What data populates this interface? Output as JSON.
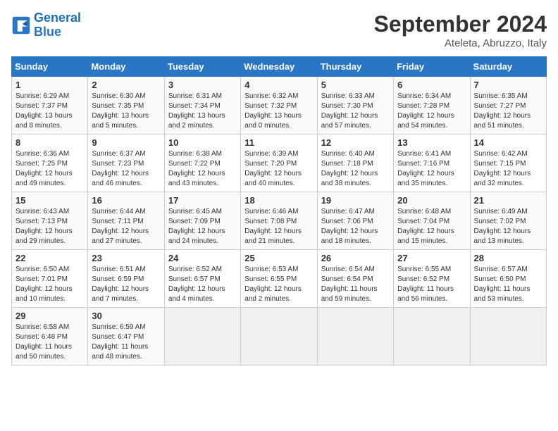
{
  "header": {
    "logo_line1": "General",
    "logo_line2": "Blue",
    "month": "September 2024",
    "location": "Ateleta, Abruzzo, Italy"
  },
  "weekdays": [
    "Sunday",
    "Monday",
    "Tuesday",
    "Wednesday",
    "Thursday",
    "Friday",
    "Saturday"
  ],
  "weeks": [
    [
      {
        "day": "1",
        "info": "Sunrise: 6:29 AM\nSunset: 7:37 PM\nDaylight: 13 hours\nand 8 minutes."
      },
      {
        "day": "2",
        "info": "Sunrise: 6:30 AM\nSunset: 7:35 PM\nDaylight: 13 hours\nand 5 minutes."
      },
      {
        "day": "3",
        "info": "Sunrise: 6:31 AM\nSunset: 7:34 PM\nDaylight: 13 hours\nand 2 minutes."
      },
      {
        "day": "4",
        "info": "Sunrise: 6:32 AM\nSunset: 7:32 PM\nDaylight: 13 hours\nand 0 minutes."
      },
      {
        "day": "5",
        "info": "Sunrise: 6:33 AM\nSunset: 7:30 PM\nDaylight: 12 hours\nand 57 minutes."
      },
      {
        "day": "6",
        "info": "Sunrise: 6:34 AM\nSunset: 7:28 PM\nDaylight: 12 hours\nand 54 minutes."
      },
      {
        "day": "7",
        "info": "Sunrise: 6:35 AM\nSunset: 7:27 PM\nDaylight: 12 hours\nand 51 minutes."
      }
    ],
    [
      {
        "day": "8",
        "info": "Sunrise: 6:36 AM\nSunset: 7:25 PM\nDaylight: 12 hours\nand 49 minutes."
      },
      {
        "day": "9",
        "info": "Sunrise: 6:37 AM\nSunset: 7:23 PM\nDaylight: 12 hours\nand 46 minutes."
      },
      {
        "day": "10",
        "info": "Sunrise: 6:38 AM\nSunset: 7:22 PM\nDaylight: 12 hours\nand 43 minutes."
      },
      {
        "day": "11",
        "info": "Sunrise: 6:39 AM\nSunset: 7:20 PM\nDaylight: 12 hours\nand 40 minutes."
      },
      {
        "day": "12",
        "info": "Sunrise: 6:40 AM\nSunset: 7:18 PM\nDaylight: 12 hours\nand 38 minutes."
      },
      {
        "day": "13",
        "info": "Sunrise: 6:41 AM\nSunset: 7:16 PM\nDaylight: 12 hours\nand 35 minutes."
      },
      {
        "day": "14",
        "info": "Sunrise: 6:42 AM\nSunset: 7:15 PM\nDaylight: 12 hours\nand 32 minutes."
      }
    ],
    [
      {
        "day": "15",
        "info": "Sunrise: 6:43 AM\nSunset: 7:13 PM\nDaylight: 12 hours\nand 29 minutes."
      },
      {
        "day": "16",
        "info": "Sunrise: 6:44 AM\nSunset: 7:11 PM\nDaylight: 12 hours\nand 27 minutes."
      },
      {
        "day": "17",
        "info": "Sunrise: 6:45 AM\nSunset: 7:09 PM\nDaylight: 12 hours\nand 24 minutes."
      },
      {
        "day": "18",
        "info": "Sunrise: 6:46 AM\nSunset: 7:08 PM\nDaylight: 12 hours\nand 21 minutes."
      },
      {
        "day": "19",
        "info": "Sunrise: 6:47 AM\nSunset: 7:06 PM\nDaylight: 12 hours\nand 18 minutes."
      },
      {
        "day": "20",
        "info": "Sunrise: 6:48 AM\nSunset: 7:04 PM\nDaylight: 12 hours\nand 15 minutes."
      },
      {
        "day": "21",
        "info": "Sunrise: 6:49 AM\nSunset: 7:02 PM\nDaylight: 12 hours\nand 13 minutes."
      }
    ],
    [
      {
        "day": "22",
        "info": "Sunrise: 6:50 AM\nSunset: 7:01 PM\nDaylight: 12 hours\nand 10 minutes."
      },
      {
        "day": "23",
        "info": "Sunrise: 6:51 AM\nSunset: 6:59 PM\nDaylight: 12 hours\nand 7 minutes."
      },
      {
        "day": "24",
        "info": "Sunrise: 6:52 AM\nSunset: 6:57 PM\nDaylight: 12 hours\nand 4 minutes."
      },
      {
        "day": "25",
        "info": "Sunrise: 6:53 AM\nSunset: 6:55 PM\nDaylight: 12 hours\nand 2 minutes."
      },
      {
        "day": "26",
        "info": "Sunrise: 6:54 AM\nSunset: 6:54 PM\nDaylight: 11 hours\nand 59 minutes."
      },
      {
        "day": "27",
        "info": "Sunrise: 6:55 AM\nSunset: 6:52 PM\nDaylight: 11 hours\nand 56 minutes."
      },
      {
        "day": "28",
        "info": "Sunrise: 6:57 AM\nSunset: 6:50 PM\nDaylight: 11 hours\nand 53 minutes."
      }
    ],
    [
      {
        "day": "29",
        "info": "Sunrise: 6:58 AM\nSunset: 6:48 PM\nDaylight: 11 hours\nand 50 minutes."
      },
      {
        "day": "30",
        "info": "Sunrise: 6:59 AM\nSunset: 6:47 PM\nDaylight: 11 hours\nand 48 minutes."
      },
      {
        "day": "",
        "info": ""
      },
      {
        "day": "",
        "info": ""
      },
      {
        "day": "",
        "info": ""
      },
      {
        "day": "",
        "info": ""
      },
      {
        "day": "",
        "info": ""
      }
    ]
  ]
}
